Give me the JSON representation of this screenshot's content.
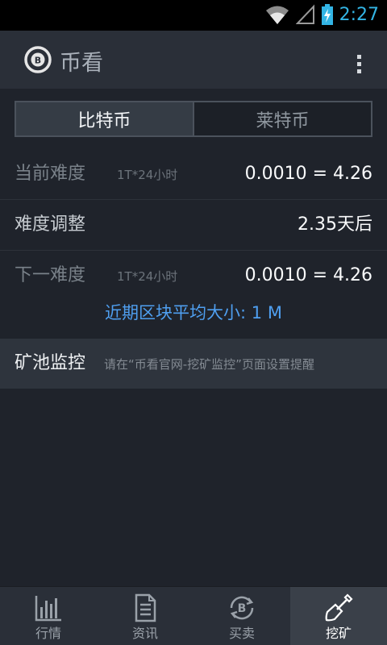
{
  "status_bar": {
    "time": "2:27"
  },
  "app": {
    "title": "币看"
  },
  "tabs": [
    {
      "label": "比特币",
      "active": true
    },
    {
      "label": "莱特币",
      "active": false
    }
  ],
  "stats": {
    "current": {
      "label": "当前难度",
      "sub": "1T*24小时",
      "value": "0.0010 = 4.26"
    },
    "adjust": {
      "label": "难度调整",
      "value": "2.35天后"
    },
    "next": {
      "label": "下一难度",
      "sub": "1T*24小时",
      "value": "0.0010 = 4.26"
    }
  },
  "block_size": "近期区块平均大小: 1 M",
  "pool": {
    "label": "矿池监控",
    "hint": "请在“币看官网-挖矿监控”页面设置提醒"
  },
  "bottom_nav": [
    {
      "label": "行情",
      "icon": "bar-chart-icon",
      "active": false
    },
    {
      "label": "资讯",
      "icon": "document-icon",
      "active": false
    },
    {
      "label": "买卖",
      "icon": "bitcoin-exchange-icon",
      "active": false
    },
    {
      "label": "挖矿",
      "icon": "shovel-icon",
      "active": true
    }
  ],
  "colors": {
    "accent": "#33b5e5",
    "link": "#4f9ff0",
    "background": "#1f232b"
  }
}
